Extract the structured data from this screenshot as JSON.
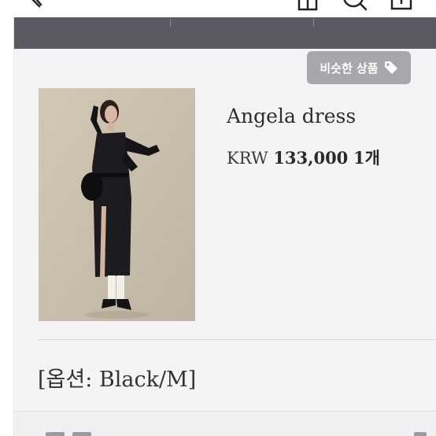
{
  "header": {
    "back_icon": "chevron-left-icon",
    "icons": [
      "home-icon",
      "search-icon",
      "share-icon"
    ]
  },
  "similar_button": {
    "label": "비슷한 상품",
    "icon": "tag-icon"
  },
  "product": {
    "name": "Angela dress",
    "currency": "KRW",
    "price": "133,000",
    "quantity": "1개"
  },
  "option": {
    "text": "[옵션: Black/M]"
  },
  "colors": {
    "dark_band": "#5a5a62",
    "card_bg": "#f4f4f6",
    "button_bg": "#a7a7ab"
  }
}
